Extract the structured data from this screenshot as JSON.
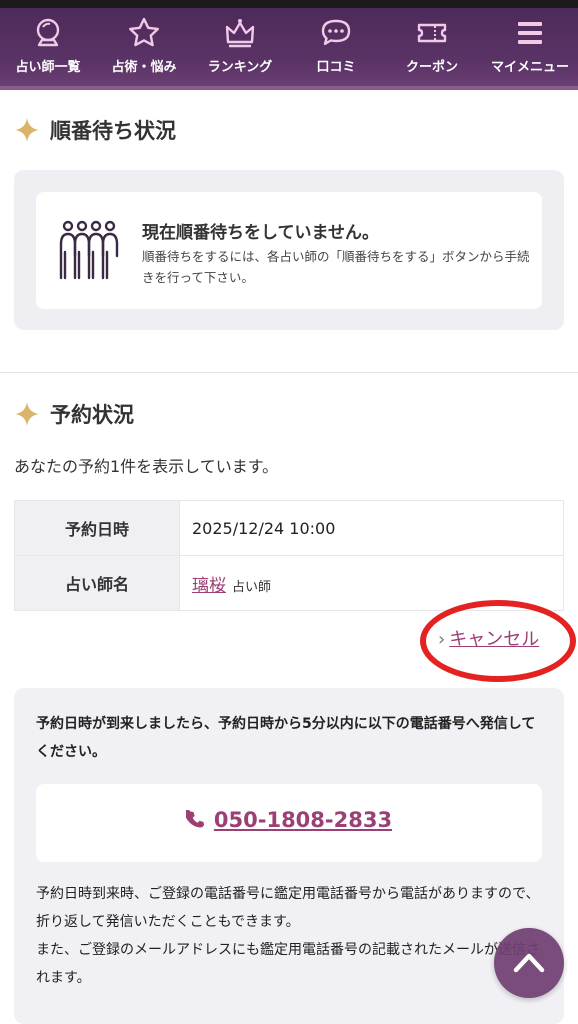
{
  "nav": {
    "items": [
      {
        "label": "占い師一覧",
        "icon": "crystal-ball-icon"
      },
      {
        "label": "占術・悩み",
        "icon": "star-icon"
      },
      {
        "label": "ランキング",
        "icon": "crown-icon"
      },
      {
        "label": "口コミ",
        "icon": "chat-bubble-icon"
      },
      {
        "label": "クーポン",
        "icon": "ticket-icon"
      },
      {
        "label": "マイメニュー",
        "icon": "menu-icon"
      }
    ]
  },
  "queue": {
    "title": "順番待ち状況",
    "headline": "現在順番待ちをしていません。",
    "description": "順番待ちをするには、各占い師の「順番待ちをする」ボタンから手続きを行って下さい。",
    "icon": "people-queue-icon"
  },
  "reservation": {
    "title": "予約状況",
    "summary": "あなたの予約1件を表示しています。",
    "rows": {
      "datetime_label": "予約日時",
      "datetime_value": "2025/12/24 10:00",
      "fortune_teller_label": "占い師名",
      "fortune_teller_name": "璃桜",
      "fortune_teller_role": "占い師"
    },
    "cancel_label": "キャンセル"
  },
  "call_info": {
    "lead": "予約日時が到来しましたら、予約日時から5分以内に以下の電話番号へ発信してください。",
    "phone_number": "050-1808-2833",
    "note_1": "予約日時到来時、ご登録の電話番号に鑑定用電話番号から電話がありますので、折り返して発信いただくこともできます。",
    "note_2": "また、ご登録のメールアドレスにも鑑定用電話番号の記載されたメールが送信されます。"
  },
  "colors": {
    "nav_bg": "#5b3366",
    "accent_link": "#9b3f74",
    "star_gold": "#d9b46a",
    "annotation_red": "#e42222"
  }
}
